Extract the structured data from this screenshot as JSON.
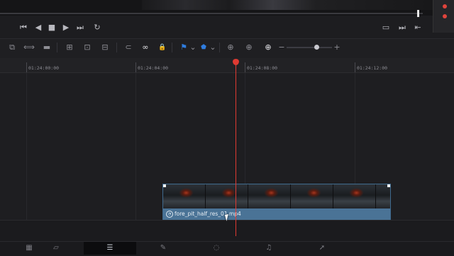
{
  "viewer": {},
  "transport": {
    "buttons": [
      {
        "name": "skip-to-start",
        "glyph": "⏮"
      },
      {
        "name": "step-back",
        "glyph": "◀"
      },
      {
        "name": "stop",
        "glyph": "■"
      },
      {
        "name": "play",
        "glyph": "▶"
      },
      {
        "name": "skip-to-end",
        "glyph": "⏭"
      },
      {
        "name": "loop",
        "glyph": "↻"
      }
    ],
    "right_buttons": [
      {
        "name": "fullscreen",
        "glyph": "▭"
      },
      {
        "name": "next-edit",
        "glyph": "⏭"
      },
      {
        "name": "prev-edit",
        "glyph": "⇤"
      }
    ]
  },
  "toolbar": {
    "tools": [
      {
        "name": "select-mode",
        "glyph": "⧉"
      },
      {
        "name": "trim-mode",
        "glyph": "⟺"
      },
      {
        "name": "blade-mode",
        "glyph": "▬"
      },
      {
        "name": "insert-clip",
        "glyph": "⊞"
      },
      {
        "name": "overwrite-clip",
        "glyph": "⊡"
      },
      {
        "name": "replace-clip",
        "glyph": "⊟"
      },
      {
        "name": "snapping",
        "glyph": "⊂"
      },
      {
        "name": "linked-selection",
        "glyph": "∞"
      },
      {
        "name": "position-lock",
        "glyph": "🔒"
      },
      {
        "name": "flag",
        "glyph": "⚑"
      },
      {
        "name": "flag-dropdown",
        "glyph": "⌄"
      },
      {
        "name": "marker",
        "glyph": "⬟"
      },
      {
        "name": "marker-dropdown",
        "glyph": "⌄"
      },
      {
        "name": "full-extent-zoom",
        "glyph": "⊕"
      },
      {
        "name": "detail-zoom",
        "glyph": "⊕"
      },
      {
        "name": "custom-zoom",
        "glyph": "⊕"
      },
      {
        "name": "zoom-out",
        "glyph": "−"
      },
      {
        "name": "zoom-in",
        "glyph": "+"
      }
    ],
    "zoom_level": 0.6
  },
  "ruler": {
    "timecodes": [
      "01:24:00:00",
      "01:24:04:00",
      "01:24:08:00",
      "01:24:12:00"
    ]
  },
  "clip": {
    "name": "fore_pit_half_res_01.mp4",
    "speed_icon": "speed-change-icon"
  },
  "page_nav": {
    "tabs": [
      {
        "name": "media-page",
        "glyph": "▦"
      },
      {
        "name": "cut-page",
        "glyph": "▱"
      },
      {
        "name": "edit-page",
        "glyph": "☰"
      },
      {
        "name": "fusion-page",
        "glyph": "✎"
      },
      {
        "name": "color-page",
        "glyph": "◌"
      },
      {
        "name": "fairlight-page",
        "glyph": "♫"
      },
      {
        "name": "deliver-page",
        "glyph": "➚"
      }
    ],
    "active": "edit-page"
  },
  "colors": {
    "playhead": "#e03a32",
    "clip": "#4a7396",
    "accent": "#2f7de0"
  }
}
